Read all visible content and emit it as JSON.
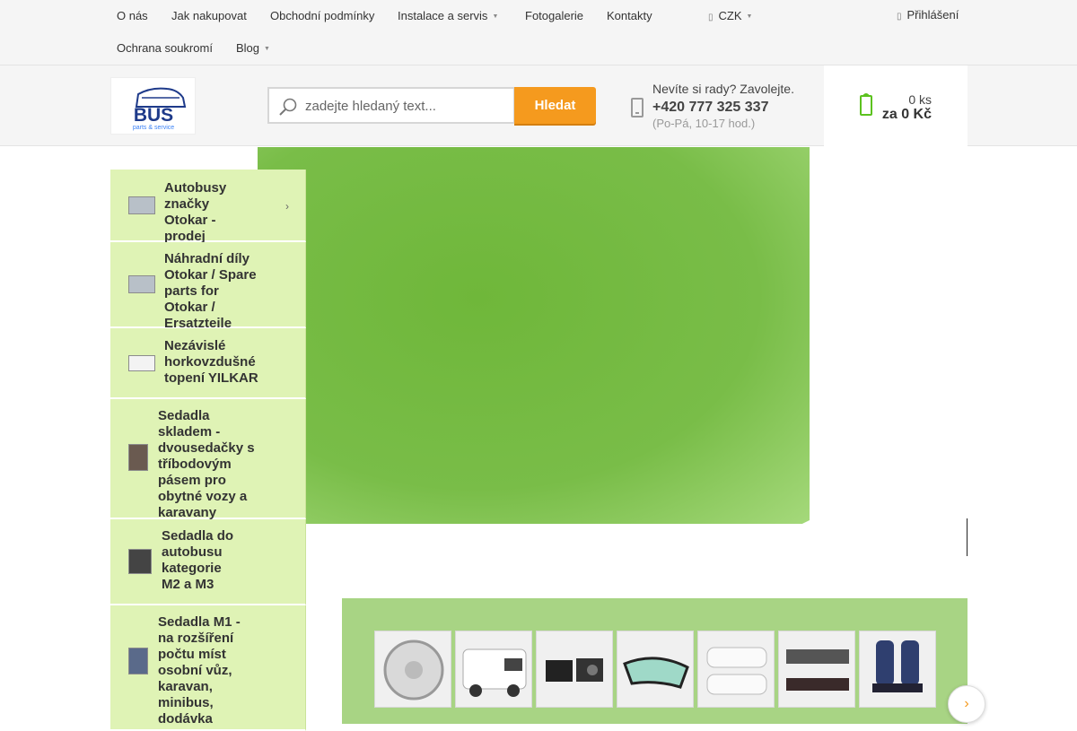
{
  "topnav": {
    "items": [
      "O nás",
      "Jak nakupovat",
      "Obchodní podmínky",
      "Instalace a servis",
      "Fotogalerie",
      "Kontakty",
      "Ochrana soukromí",
      "Blog"
    ],
    "currency": "CZK",
    "login": "Přihlášení"
  },
  "logo": {
    "text": "BUS",
    "subtext": "parts & service"
  },
  "search": {
    "placeholder": "zadejte hledaný text...",
    "button": "Hledat"
  },
  "contact": {
    "question": "Nevíte si rady? Zavolejte.",
    "phone": "+420 777 325 337",
    "hours": "(Po-Pá, 10-17 hod.)"
  },
  "cart": {
    "qty": "0 ks",
    "total": "za 0 Kč"
  },
  "categories": [
    {
      "label": "Autobusy značky Otokar - prodej",
      "icon": "bus-thumb"
    },
    {
      "label": "Náhradní díly Otokar / Spare parts for Otokar / Ersatzteile",
      "icon": "bus-thumb"
    },
    {
      "label": "Nezávislé horkovzdušné topení YILKAR",
      "icon": "heater-thumb"
    },
    {
      "label": "Sedadla skladem - dvousedačky s tříbodovým pásem pro obytné vozy a karavany",
      "icon": "seat-thumb"
    },
    {
      "label": "Sedadla do autobusu kategorie M2 a M3",
      "icon": "seat-thumb"
    },
    {
      "label": "Sedadla M1 - na rozšíření počtu míst osobní vůz, karavan, minibus, dodávka",
      "icon": "seat-thumb"
    }
  ],
  "colors": {
    "accent": "#f59a1e",
    "category_bg": "#dff3b5",
    "banner_green": "#79bd48"
  }
}
